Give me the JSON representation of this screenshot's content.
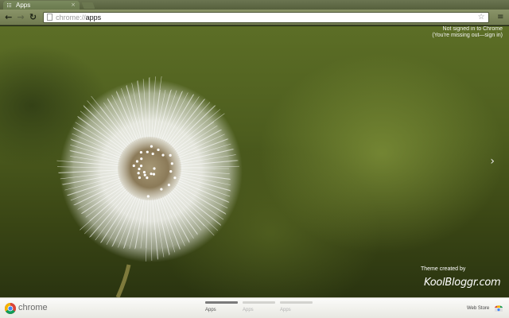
{
  "browser": {
    "tab": {
      "title": "Apps",
      "close_glyph": "×",
      "favicon": "apps-grid-icon"
    },
    "toolbar": {
      "back_glyph": "←",
      "forward_glyph": "→",
      "reload_glyph": "↻",
      "url_scheme": "chrome://",
      "url_host": "apps",
      "star_glyph": "☆",
      "menu_glyph": "≡"
    }
  },
  "signin": {
    "line1": "Not signed in to Chrome",
    "line2": "(You're missing out—sign in)"
  },
  "content": {
    "next_page_glyph": "›",
    "theme_credit": "Theme created by",
    "theme_brand": "KoolBloggr.com"
  },
  "bottombar": {
    "logo_text": "chrome",
    "pages": [
      {
        "label": "Apps",
        "active": true
      },
      {
        "label": "Apps",
        "active": false
      },
      {
        "label": "Apps",
        "active": false
      }
    ],
    "webstore_label": "Web Store"
  },
  "colors": {
    "background_green": "#4d5d1e",
    "toolbar": "#7d8760",
    "bottombar": "#f2f2ee"
  }
}
